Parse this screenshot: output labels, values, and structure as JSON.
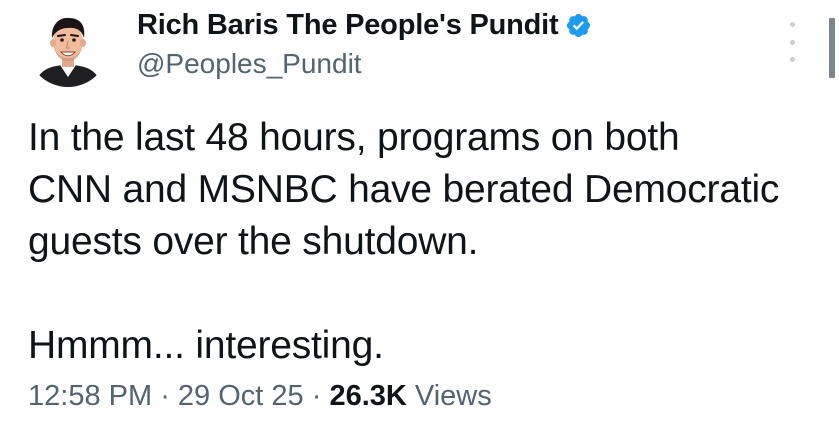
{
  "author": {
    "display_name": "Rich Baris The People's Pundit",
    "handle": "@Peoples_Pundit",
    "verified_icon": "verified-badge-icon",
    "badge_color": "#1d9bf0"
  },
  "tweet": {
    "lines": [
      "In the last 48 hours, programs on both",
      "CNN and MSNBC have berated Democratic",
      "guests over the shutdown."
    ],
    "second_paragraph": "Hmmm... interesting."
  },
  "meta": {
    "time": "12:58 PM",
    "separator": " · ",
    "date": "29 Oct 25",
    "views_count": "26.3K",
    "views_label": " Views"
  },
  "icons": {
    "more": "more-options-icon"
  }
}
